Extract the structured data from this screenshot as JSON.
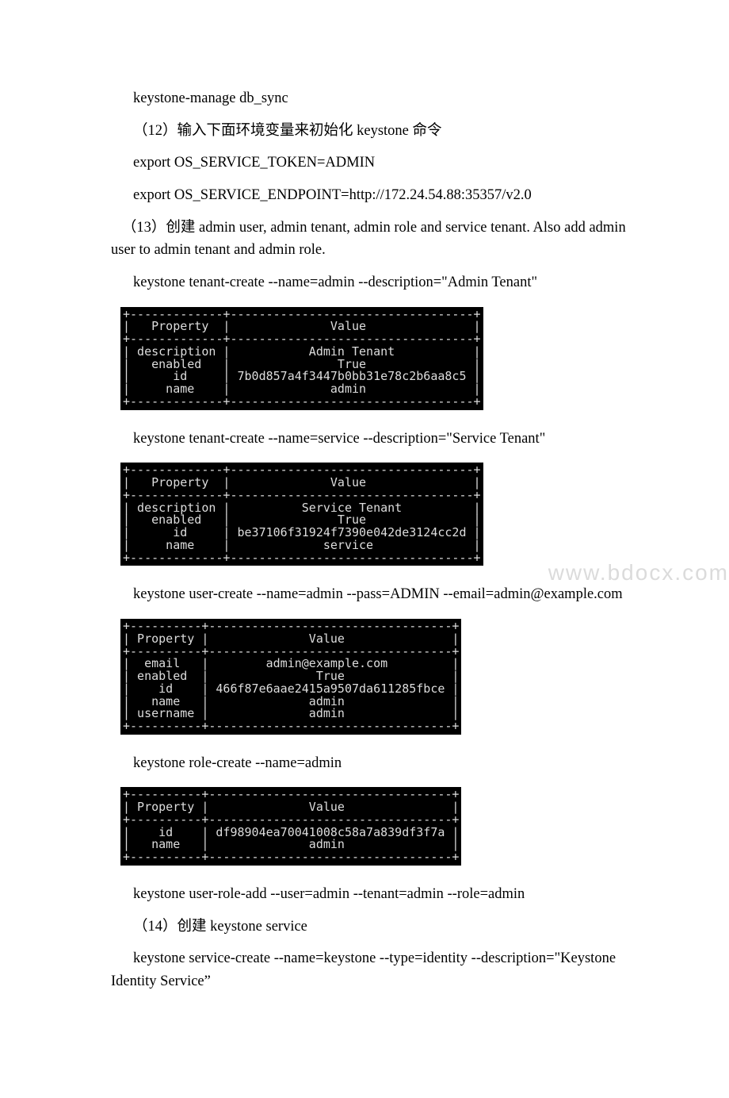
{
  "lines": {
    "l1": "keystone-manage db_sync",
    "l2": "（12）输入下面环境变量来初始化 keystone 命令",
    "l3": "export OS_SERVICE_TOKEN=ADMIN",
    "l4": "export OS_SERVICE_ENDPOINT=http://172.24.54.88:35357/v2.0",
    "l5": "   （13）创建 admin user, admin tenant, admin role and service tenant. Also add admin user to admin tenant and admin role.",
    "l6": "keystone tenant-create --name=admin --description=\"Admin Tenant\"",
    "l7": "keystone tenant-create --name=service --description=\"Service Tenant\"",
    "l8": "keystone user-create --name=admin --pass=ADMIN --email=admin@example.com",
    "l9": "keystone role-create --name=admin",
    "l10": "keystone user-role-add --user=admin --tenant=admin --role=admin",
    "l11": "（14）创建 keystone service",
    "l12": "keystone service-create --name=keystone --type=identity --description=\"Keystone Identity Service”"
  },
  "terminals": {
    "t1": "+-------------+----------------------------------+\n|   Property  |              Value               |\n+-------------+----------------------------------+\n| description |           Admin Tenant           |\n|   enabled   |               True               |\n|      id     | 7b0d857a4f3447b0bb31e78c2b6aa8c5 |\n|     name    |              admin               |\n+-------------+----------------------------------+",
    "t2": "+-------------+----------------------------------+\n|   Property  |              Value               |\n+-------------+----------------------------------+\n| description |          Service Tenant          |\n|   enabled   |               True               |\n|      id     | be37106f31924f7390e042de3124cc2d |\n|     name    |             service              |\n+-------------+----------------------------------+",
    "t3": "+----------+----------------------------------+\n| Property |              Value               |\n+----------+----------------------------------+\n|  email   |        admin@example.com         |\n| enabled  |               True               |\n|    id    | 466f87e6aae2415a9507da611285fbce |\n|   name   |              admin               |\n| username |              admin               |\n+----------+----------------------------------+",
    "t4": "+----------+----------------------------------+\n| Property |              Value               |\n+----------+----------------------------------+\n|    id    | df98904ea70041008c58a7a839df3f7a |\n|   name   |              admin               |\n+----------+----------------------------------+"
  },
  "watermark": "www.bdocx.com",
  "chart_data": [
    {
      "type": "table",
      "title": "keystone tenant-create admin",
      "columns": [
        "Property",
        "Value"
      ],
      "rows": [
        [
          "description",
          "Admin Tenant"
        ],
        [
          "enabled",
          "True"
        ],
        [
          "id",
          "7b0d857a4f3447b0bb31e78c2b6aa8c5"
        ],
        [
          "name",
          "admin"
        ]
      ]
    },
    {
      "type": "table",
      "title": "keystone tenant-create service",
      "columns": [
        "Property",
        "Value"
      ],
      "rows": [
        [
          "description",
          "Service Tenant"
        ],
        [
          "enabled",
          "True"
        ],
        [
          "id",
          "be37106f31924f7390e042de3124cc2d"
        ],
        [
          "name",
          "service"
        ]
      ]
    },
    {
      "type": "table",
      "title": "keystone user-create admin",
      "columns": [
        "Property",
        "Value"
      ],
      "rows": [
        [
          "email",
          "admin@example.com"
        ],
        [
          "enabled",
          "True"
        ],
        [
          "id",
          "466f87e6aae2415a9507da611285fbce"
        ],
        [
          "name",
          "admin"
        ],
        [
          "username",
          "admin"
        ]
      ]
    },
    {
      "type": "table",
      "title": "keystone role-create admin",
      "columns": [
        "Property",
        "Value"
      ],
      "rows": [
        [
          "id",
          "df98904ea70041008c58a7a839df3f7a"
        ],
        [
          "name",
          "admin"
        ]
      ]
    }
  ]
}
